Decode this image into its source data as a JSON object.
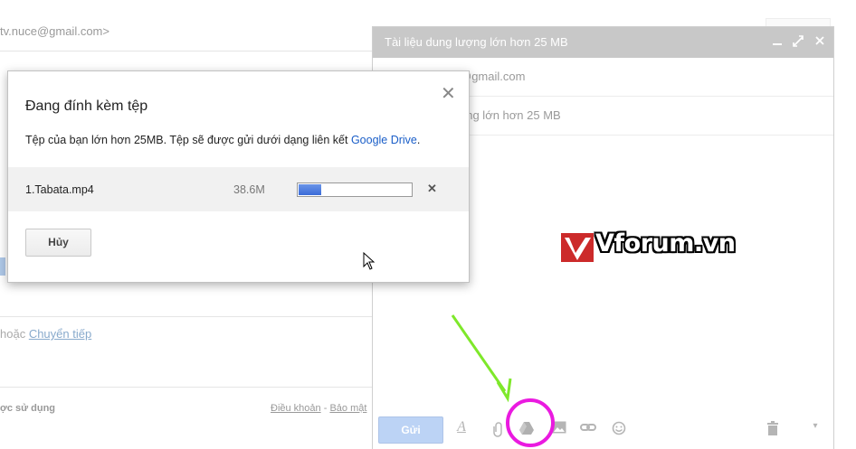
{
  "background": {
    "sender_email": "tv.nuce@gmail.com>",
    "forward_prefix": "hoặc ",
    "forward_link": "Chuyển tiếp",
    "footer_left": "ợc sử dụng",
    "footer_terms": "Điều khoản",
    "footer_sep": " - ",
    "footer_privacy": "Bảo mật"
  },
  "compose": {
    "title": "Tài liệu dung lượng lớn hơn 25 MB",
    "to_value": "@gmail.com",
    "subject_value": "ung lớn hơn 25 MB",
    "send_label": "Gửi",
    "header_icons": [
      "minimize-icon",
      "expand-icon",
      "close-icon"
    ],
    "toolbar_icons": [
      "format-text-icon",
      "attach-icon",
      "google-drive-icon",
      "insert-photo-icon",
      "insert-link-icon",
      "emoji-icon",
      "trash-icon",
      "more-options-icon"
    ]
  },
  "watermark": {
    "text": "Vforum.vn",
    "color": "#cc2a2a"
  },
  "dialog": {
    "title": "Đang đính kèm tệp",
    "description": "Tệp của bạn lớn hơn 25MB. Tệp sẽ được gửi dưới dạng liên kết ",
    "drive_link": "Google Drive",
    "description_end": ".",
    "file": {
      "name": "1.Tabata.mp4",
      "size": "38.6M",
      "progress": 0.2
    },
    "cancel_label": "Hủy"
  },
  "colors": {
    "link": "#1a5ec8",
    "progress": "#3a6bd8",
    "annotation_circle": "#ea1ae0",
    "annotation_arrow": "#7ee82a",
    "send_button": "#bcd3f5"
  }
}
